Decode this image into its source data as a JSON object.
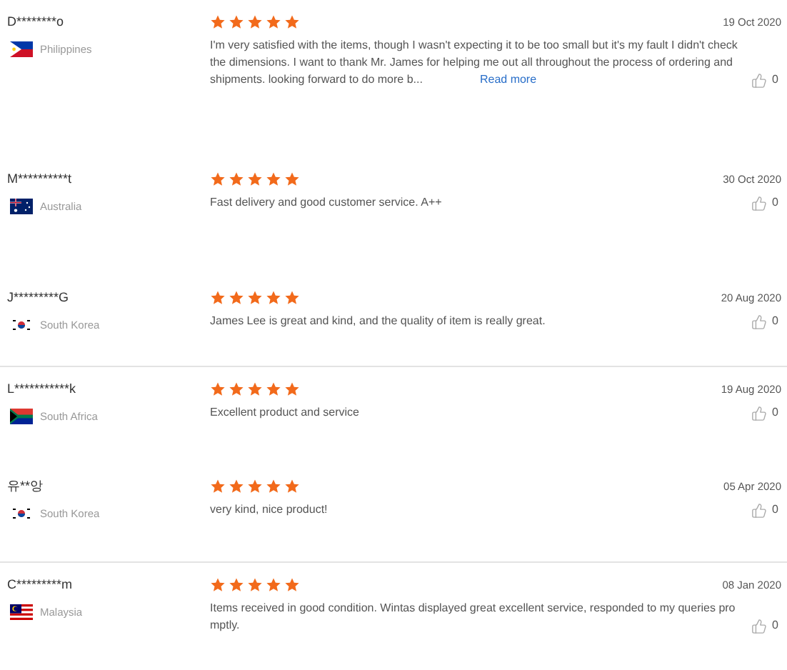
{
  "reviews": [
    {
      "name": "D********o",
      "country": "Philippines",
      "kind": "ph",
      "stars": 5,
      "date": "19 Oct 2020",
      "comment": "I'm very satisfied with the items, though I wasn't expecting it to be too small but it's my fault I didn't check the dimensions. I want to thank Mr. James for helping me out all throughout the process of ordering and shipments. looking forward to do more b...",
      "read_more": "Read more",
      "likes": "0",
      "divider": false
    },
    {
      "name": "M**********t",
      "country": "Australia",
      "kind": "au",
      "stars": 5,
      "date": "30 Oct 2020",
      "comment": "Fast delivery and good customer service. A++",
      "likes": "0",
      "divider": false
    },
    {
      "name": "J*********G",
      "country": "South Korea",
      "kind": "kr",
      "stars": 5,
      "date": "20 Aug 2020",
      "comment": "James Lee is great and kind, and the quality of item is really great.",
      "likes": "0",
      "divider": false
    },
    {
      "name": "L***********k",
      "country": "South Africa",
      "kind": "za",
      "stars": 5,
      "date": "19 Aug 2020",
      "comment": "Excellent product and service",
      "likes": "0",
      "divider": true
    },
    {
      "name": "유**앙",
      "country": "South Korea",
      "kind": "kr",
      "stars": 5,
      "date": "05 Apr 2020",
      "comment": "very kind, nice product!",
      "likes": "0",
      "divider": false
    },
    {
      "name": "C*********m",
      "country": "Malaysia",
      "kind": "my",
      "stars": 5,
      "date": "08 Jan 2020",
      "comment": "Items received in good condition. Wintas displayed great excellent service, responded to my queries promptly.",
      "likes": "0",
      "divider": true
    }
  ]
}
